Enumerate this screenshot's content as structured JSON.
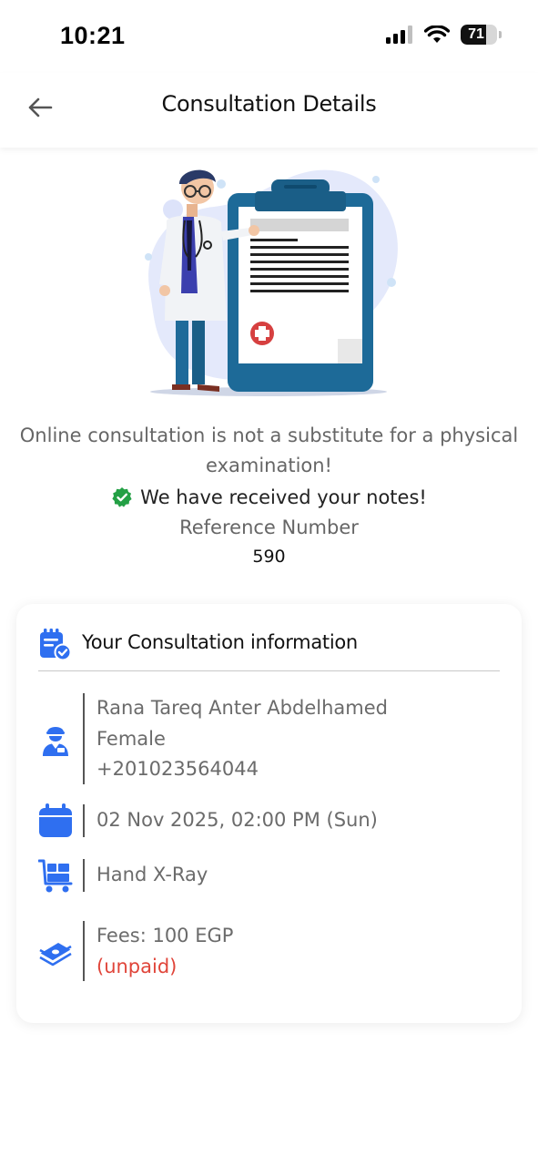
{
  "status_bar": {
    "time": "10:21",
    "battery_level": "71",
    "battery_fraction": 0.71
  },
  "header": {
    "title": "Consultation Details"
  },
  "message": {
    "disclaimer_line1": "Online consultation is not a substitute for a physical",
    "disclaimer_line2": "examination!",
    "received": "We have received your notes!",
    "reference_label": "Reference Number",
    "reference_number": "590"
  },
  "card": {
    "title": "Your Consultation information",
    "patient": {
      "name": "Rana Tareq Anter Abdelhamed",
      "gender": "Female",
      "phone": "+201023564044"
    },
    "appointment": {
      "datetime": "02 Nov 2025, 02:00 PM (Sun)"
    },
    "service": {
      "name": "Hand X-Ray"
    },
    "fees": {
      "text": "Fees: 100 EGP",
      "status": "(unpaid)"
    }
  },
  "colors": {
    "accent": "#2f6ff0",
    "success": "#23a045",
    "unpaid": "#e0453a",
    "clipboard": "#1f6f9e"
  }
}
